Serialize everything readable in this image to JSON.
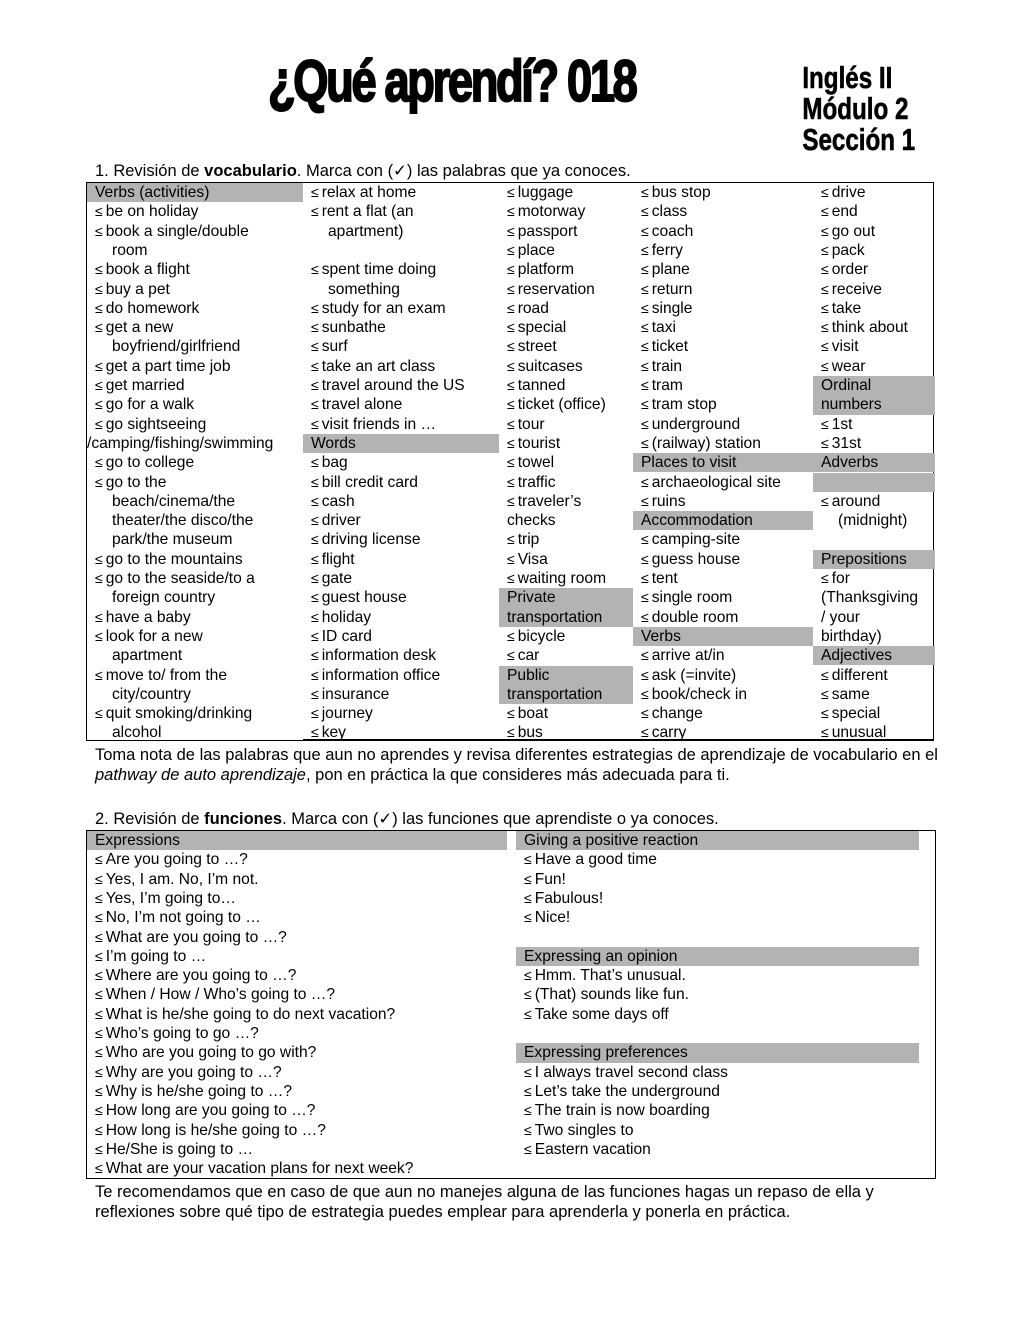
{
  "header": {
    "title": "¿Qué aprendí? 018",
    "course_lines": [
      "Inglés II",
      "Módulo 2",
      "Sección 1"
    ]
  },
  "checkbox_glyph": "≤",
  "section1": {
    "number": "1. Revisión de ",
    "bold": "vocabulario",
    "rest": ". Marca  con (✓) las palabras que ya conoces."
  },
  "vocab_columns": [
    [
      {
        "text": "Verbs (activities)",
        "type": "head"
      },
      {
        "text": "be on holiday",
        "type": "item"
      },
      {
        "text": "book a single/double",
        "type": "item"
      },
      {
        "text": "room",
        "type": "cont"
      },
      {
        "text": "book a flight",
        "type": "item"
      },
      {
        "text": "buy a pet",
        "type": "item"
      },
      {
        "text": "do homework",
        "type": "item"
      },
      {
        "text": "get a new",
        "type": "item"
      },
      {
        "text": "boyfriend/girlfriend",
        "type": "cont"
      },
      {
        "text": "get a part time job",
        "type": "item"
      },
      {
        "text": "get married",
        "type": "item"
      },
      {
        "text": "go for a walk",
        "type": "item"
      },
      {
        "text": "go sightseeing",
        "type": "item"
      },
      {
        "text": "/camping/fishing/swimming",
        "type": "plain"
      },
      {
        "text": "go to college",
        "type": "item"
      },
      {
        "text": "go to the",
        "type": "item"
      },
      {
        "text": "beach/cinema/the",
        "type": "cont"
      },
      {
        "text": "theater/the disco/the",
        "type": "cont"
      },
      {
        "text": "park/the museum",
        "type": "cont"
      },
      {
        "text": "go to the mountains",
        "type": "item"
      },
      {
        "text": "go to the seaside/to a",
        "type": "item"
      },
      {
        "text": "foreign country",
        "type": "cont"
      },
      {
        "text": "have a baby",
        "type": "item"
      },
      {
        "text": "look for a new",
        "type": "item"
      },
      {
        "text": "apartment",
        "type": "cont"
      },
      {
        "text": "move to/ from the",
        "type": "item"
      },
      {
        "text": "city/country",
        "type": "cont"
      },
      {
        "text": "quit smoking/drinking",
        "type": "item"
      },
      {
        "text": "alcohol",
        "type": "cont"
      }
    ],
    [
      {
        "text": "relax at home",
        "type": "item"
      },
      {
        "text": "rent a flat (an",
        "type": "item"
      },
      {
        "text": "apartment)",
        "type": "cont"
      },
      {
        "text": "",
        "type": "blank"
      },
      {
        "text": "spent time doing",
        "type": "item"
      },
      {
        "text": "something",
        "type": "cont"
      },
      {
        "text": "study for an exam",
        "type": "item"
      },
      {
        "text": "sunbathe",
        "type": "item"
      },
      {
        "text": "surf",
        "type": "item"
      },
      {
        "text": "take an art class",
        "type": "item"
      },
      {
        "text": "travel around the US",
        "type": "item"
      },
      {
        "text": "travel alone",
        "type": "item"
      },
      {
        "text": "visit friends in …",
        "type": "item"
      },
      {
        "text": "Words",
        "type": "head"
      },
      {
        "text": "bag",
        "type": "item"
      },
      {
        "text": "bill credit card",
        "type": "item"
      },
      {
        "text": "cash",
        "type": "item"
      },
      {
        "text": "driver",
        "type": "item"
      },
      {
        "text": "driving license",
        "type": "item"
      },
      {
        "text": "flight",
        "type": "item"
      },
      {
        "text": "gate",
        "type": "item"
      },
      {
        "text": "guest house",
        "type": "item"
      },
      {
        "text": "holiday",
        "type": "item"
      },
      {
        "text": "ID card",
        "type": "item"
      },
      {
        "text": "information desk",
        "type": "item"
      },
      {
        "text": "information office",
        "type": "item"
      },
      {
        "text": "insurance",
        "type": "item"
      },
      {
        "text": "journey",
        "type": "item"
      },
      {
        "text": "key",
        "type": "item"
      }
    ],
    [
      {
        "text": "luggage",
        "type": "item"
      },
      {
        "text": "motorway",
        "type": "item"
      },
      {
        "text": "passport",
        "type": "item"
      },
      {
        "text": "place",
        "type": "item"
      },
      {
        "text": "platform",
        "type": "item"
      },
      {
        "text": "reservation",
        "type": "item"
      },
      {
        "text": "road",
        "type": "item"
      },
      {
        "text": "special",
        "type": "item"
      },
      {
        "text": "street",
        "type": "item"
      },
      {
        "text": "suitcases",
        "type": "item"
      },
      {
        "text": "tanned",
        "type": "item"
      },
      {
        "text": "ticket (office)",
        "type": "item"
      },
      {
        "text": "tour",
        "type": "item"
      },
      {
        "text": "tourist",
        "type": "item"
      },
      {
        "text": "towel",
        "type": "item"
      },
      {
        "text": "traffic",
        "type": "item"
      },
      {
        "text": "traveler’s",
        "type": "item"
      },
      {
        "text": "checks",
        "type": "plain"
      },
      {
        "text": "trip",
        "type": "item"
      },
      {
        "text": "Visa",
        "type": "item"
      },
      {
        "text": "waiting room",
        "type": "item"
      },
      {
        "text": "Private",
        "type": "head"
      },
      {
        "text": "transportation",
        "type": "head"
      },
      {
        "text": "bicycle",
        "type": "item"
      },
      {
        "text": "car",
        "type": "item"
      },
      {
        "text": "Public",
        "type": "head"
      },
      {
        "text": "transportation",
        "type": "head"
      },
      {
        "text": "boat",
        "type": "item"
      },
      {
        "text": "bus",
        "type": "item"
      }
    ],
    [
      {
        "text": "bus stop",
        "type": "item"
      },
      {
        "text": "class",
        "type": "item"
      },
      {
        "text": "coach",
        "type": "item"
      },
      {
        "text": "ferry",
        "type": "item"
      },
      {
        "text": "plane",
        "type": "item"
      },
      {
        "text": "return",
        "type": "item"
      },
      {
        "text": "single",
        "type": "item"
      },
      {
        "text": "taxi",
        "type": "item"
      },
      {
        "text": "ticket",
        "type": "item"
      },
      {
        "text": "train",
        "type": "item"
      },
      {
        "text": "tram",
        "type": "item"
      },
      {
        "text": "tram stop",
        "type": "item"
      },
      {
        "text": "underground",
        "type": "item"
      },
      {
        "text": "(railway) station",
        "type": "item"
      },
      {
        "text": "Places to visit",
        "type": "head"
      },
      {
        "text": "archaeological site",
        "type": "item"
      },
      {
        "text": "ruins",
        "type": "item"
      },
      {
        "text": "Accommodation",
        "type": "head"
      },
      {
        "text": "camping-site",
        "type": "item"
      },
      {
        "text": "guess house",
        "type": "item"
      },
      {
        "text": "tent",
        "type": "item"
      },
      {
        "text": "single room",
        "type": "item"
      },
      {
        "text": "double room",
        "type": "item"
      },
      {
        "text": "Verbs",
        "type": "head"
      },
      {
        "text": "arrive at/in",
        "type": "item"
      },
      {
        "text": "ask (=invite)",
        "type": "item"
      },
      {
        "text": "book/check in",
        "type": "item"
      },
      {
        "text": "change",
        "type": "item"
      },
      {
        "text": "carry",
        "type": "item"
      }
    ],
    [
      {
        "text": "drive",
        "type": "item"
      },
      {
        "text": "end",
        "type": "item"
      },
      {
        "text": "go out",
        "type": "item"
      },
      {
        "text": "pack",
        "type": "item"
      },
      {
        "text": "order",
        "type": "item"
      },
      {
        "text": "receive",
        "type": "item"
      },
      {
        "text": "take",
        "type": "item"
      },
      {
        "text": "think about",
        "type": "item"
      },
      {
        "text": "visit",
        "type": "item"
      },
      {
        "text": "wear",
        "type": "item"
      },
      {
        "text": "Ordinal",
        "type": "head"
      },
      {
        "text": "numbers",
        "type": "head"
      },
      {
        "text": "1st",
        "type": "item"
      },
      {
        "text": "31st",
        "type": "item"
      },
      {
        "text": "Adverbs",
        "type": "head"
      },
      {
        "text": "",
        "type": "head"
      },
      {
        "text": "around",
        "type": "item"
      },
      {
        "text": "(midnight)",
        "type": "cont"
      },
      {
        "text": "",
        "type": "blank"
      },
      {
        "text": "Prepositions",
        "type": "head"
      },
      {
        "text": "for",
        "type": "item"
      },
      {
        "text": "(Thanksgiving",
        "type": "plain"
      },
      {
        "text": "/ your",
        "type": "plain"
      },
      {
        "text": "birthday)",
        "type": "plain"
      },
      {
        "text": "Adjectives",
        "type": "head"
      },
      {
        "text": "different",
        "type": "item"
      },
      {
        "text": "same",
        "type": "item"
      },
      {
        "text": "special",
        "type": "item"
      },
      {
        "text": "unusual",
        "type": "item"
      }
    ]
  ],
  "note1": {
    "before": "Toma nota de las palabras que aun no aprendes y revisa diferentes estrategias de aprendizaje de vocabulario en el ",
    "italic": "pathway de auto aprendizaje",
    "after": ", pon en práctica la que consideres más adecuada para ti."
  },
  "section2": {
    "number": "2. Revisión de ",
    "bold": "funciones",
    "rest": ". Marca con (✓) las funciones que aprendiste o ya conoces."
  },
  "functions": {
    "left": [
      {
        "text": "Expressions",
        "type": "head"
      },
      {
        "text": "Are you going to …?",
        "type": "item"
      },
      {
        "text": "Yes, I am. No, I’m not.",
        "type": "item"
      },
      {
        "text": "Yes, I’m going to…",
        "type": "item"
      },
      {
        "text": "No, I’m not going to …",
        "type": "item"
      },
      {
        "text": "What are you going to …?",
        "type": "item"
      },
      {
        "text": "I’m going to …",
        "type": "item"
      },
      {
        "text": "Where are you going to …?",
        "type": "item"
      },
      {
        "text": "When / How / Who’s going to …?",
        "type": "item"
      },
      {
        "text": "What is he/she going to do next vacation?",
        "type": "item"
      },
      {
        "text": "Who’s going to go …?",
        "type": "item"
      },
      {
        "text": "Who are you going to go with?",
        "type": "item"
      },
      {
        "text": "Why are you going to …?",
        "type": "item"
      },
      {
        "text": "Why is he/she going to …?",
        "type": "item"
      },
      {
        "text": "How long are you going to …?",
        "type": "item"
      },
      {
        "text": "How long is he/she going to …?",
        "type": "item"
      },
      {
        "text": "He/She is going to …",
        "type": "item"
      },
      {
        "text": "What are your vacation plans for next week?",
        "type": "item"
      }
    ],
    "right": [
      {
        "text": "Giving a positive reaction",
        "type": "head"
      },
      {
        "text": "Have a good time",
        "type": "item"
      },
      {
        "text": "Fun!",
        "type": "item"
      },
      {
        "text": "Fabulous!",
        "type": "item"
      },
      {
        "text": "Nice!",
        "type": "item"
      },
      {
        "text": "",
        "type": "blank"
      },
      {
        "text": "Expressing an opinion",
        "type": "head"
      },
      {
        "text": "Hmm. That’s unusual.",
        "type": "item"
      },
      {
        "text": "(That) sounds like fun.",
        "type": "item"
      },
      {
        "text": "Take some days off",
        "type": "item"
      },
      {
        "text": "",
        "type": "blank"
      },
      {
        "text": "Expressing preferences",
        "type": "head"
      },
      {
        "text": "I always travel second class",
        "type": "item"
      },
      {
        "text": "Let’s take the underground",
        "type": "item"
      },
      {
        "text": "The train is now boarding",
        "type": "item"
      },
      {
        "text": "Two singles to",
        "type": "item"
      },
      {
        "text": "Eastern vacation",
        "type": "item"
      }
    ]
  },
  "note2": "Te recomendamos que en caso de que aun no manejes alguna de las funciones hagas un repaso de ella y reflexiones sobre qué tipo de estrategia puedes emplear para aprenderla y ponerla en práctica."
}
